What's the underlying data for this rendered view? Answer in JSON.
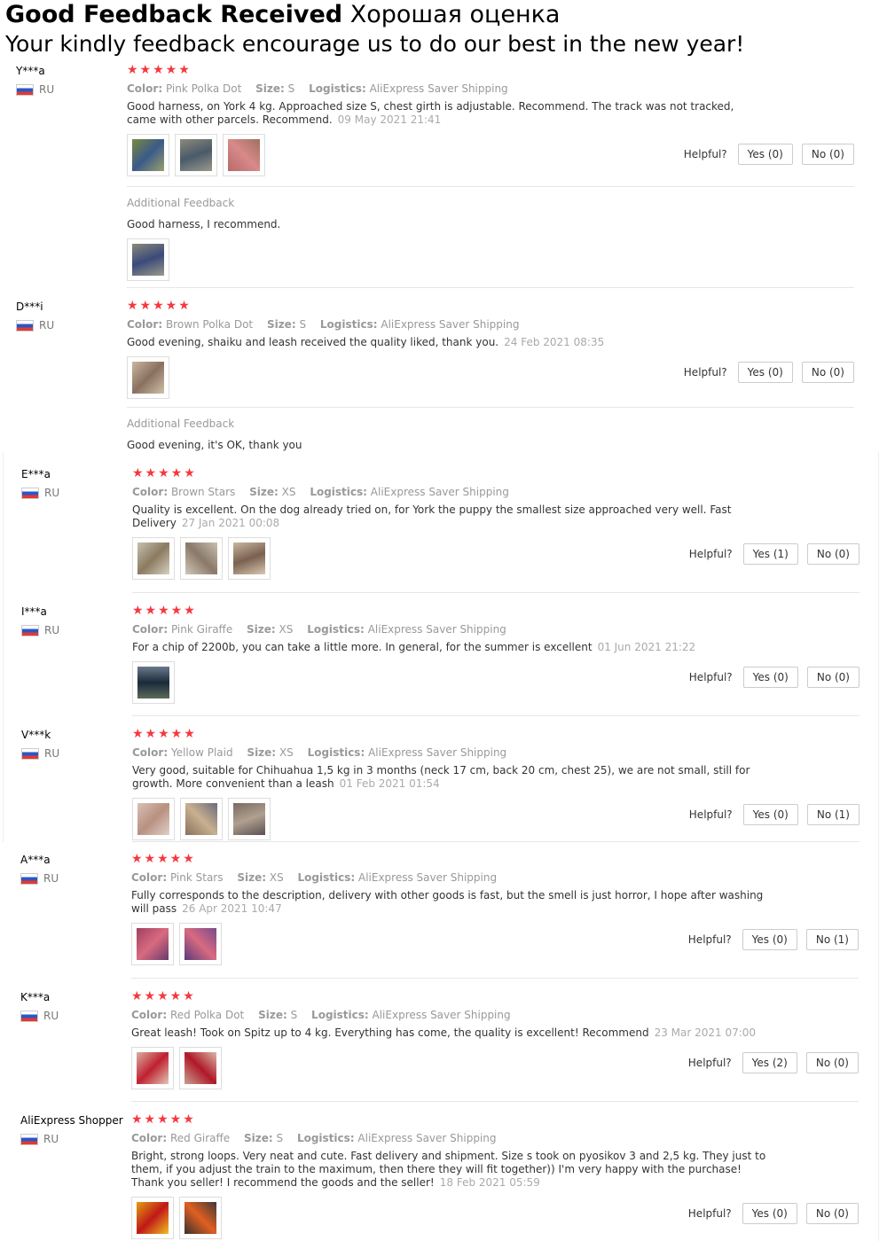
{
  "header": {
    "title_bold": "Good Feedback Received",
    "title_ru": "Хорошая оценка",
    "subtitle": "Your kindly feedback encourage us to do our best in the new year!"
  },
  "labels": {
    "stars": "★★★★★",
    "color": "Color:",
    "size": "Size:",
    "logistics": "Logistics:",
    "helpful": "Helpful?",
    "additional": "Additional Feedback"
  },
  "colors": {
    "star": "#f5383f",
    "meta": "#999999",
    "text": "#333333"
  },
  "reviews": [
    {
      "user": "Y***a",
      "country": "RU",
      "color": "Pink Polka Dot",
      "size": "S",
      "logistics": "AliExpress Saver Shipping",
      "text": "Good harness, on York 4 kg. Approached size S, chest girth is adjustable. Recommend. The track was not tracked, came with other parcels. Recommend.",
      "date": "09 May 2021 21:41",
      "yes": "Yes (0)",
      "no": "No (0)",
      "additional_text": "Good harness, I recommend."
    },
    {
      "user": "D***i",
      "country": "RU",
      "color": "Brown Polka Dot",
      "size": "S",
      "logistics": "AliExpress Saver Shipping",
      "text": "Good evening, shaiku and leash received the quality liked, thank you.",
      "date": "24 Feb 2021 08:35",
      "yes": "Yes (0)",
      "no": "No (0)",
      "additional_text": "Good evening, it's OK, thank you"
    },
    {
      "user": "E***a",
      "country": "RU",
      "color": "Brown Stars",
      "size": "XS",
      "logistics": "AliExpress Saver Shipping",
      "text": "Quality is excellent. On the dog already tried on, for York the puppy the smallest size approached very well. Fast Delivery",
      "date": "27 Jan 2021 00:08",
      "yes": "Yes (1)",
      "no": "No (0)"
    },
    {
      "user": "I***a",
      "country": "RU",
      "color": "Pink Giraffe",
      "size": "XS",
      "logistics": "AliExpress Saver Shipping",
      "text": "For a chip of 2200b, you can take a little more. In general, for the summer is excellent",
      "date": "01 Jun 2021 21:22",
      "yes": "Yes (0)",
      "no": "No (0)"
    },
    {
      "user": "V***k",
      "country": "RU",
      "color": "Yellow Plaid",
      "size": "XS",
      "logistics": "AliExpress Saver Shipping",
      "text": "Very good, suitable for Chihuahua 1,5 kg in 3 months (neck 17 cm, back 20 cm, chest 25), we are not small, still for growth. More convenient than a leash",
      "date": "01 Feb 2021 01:54",
      "yes": "Yes (0)",
      "no": "No (1)"
    },
    {
      "user": "A***a",
      "country": "RU",
      "color": "Pink Stars",
      "size": "XS",
      "logistics": "AliExpress Saver Shipping",
      "text": "Fully corresponds to the description, delivery with other goods is fast, but the smell is just horror, I hope after washing will pass",
      "date": "26 Apr 2021 10:47",
      "yes": "Yes (0)",
      "no": "No (1)"
    },
    {
      "user": "K***a",
      "country": "RU",
      "color": "Red Polka Dot",
      "size": "S",
      "logistics": "AliExpress Saver Shipping",
      "text": "Great leash! Took on Spitz up to 4 kg. Everything has come, the quality is excellent! Recommend",
      "date": "23 Mar 2021 07:00",
      "yes": "Yes (2)",
      "no": "No (0)"
    },
    {
      "user": "AliExpress Shopper",
      "country": "RU",
      "color": "Red Giraffe",
      "size": "S",
      "logistics": "AliExpress Saver Shipping",
      "text": "Bright, strong loops. Very neat and cute. Fast delivery and shipment. Size s took on pyosikov 3 and 2,5 kg. They just to them, if you adjust the train to the maximum, then there they will fit together)) I'm very happy with the purchase! Thank you seller! I recommend the goods and the seller!",
      "date": "18 Feb 2021 05:59",
      "yes": "Yes (0)",
      "no": "No (0)"
    }
  ]
}
